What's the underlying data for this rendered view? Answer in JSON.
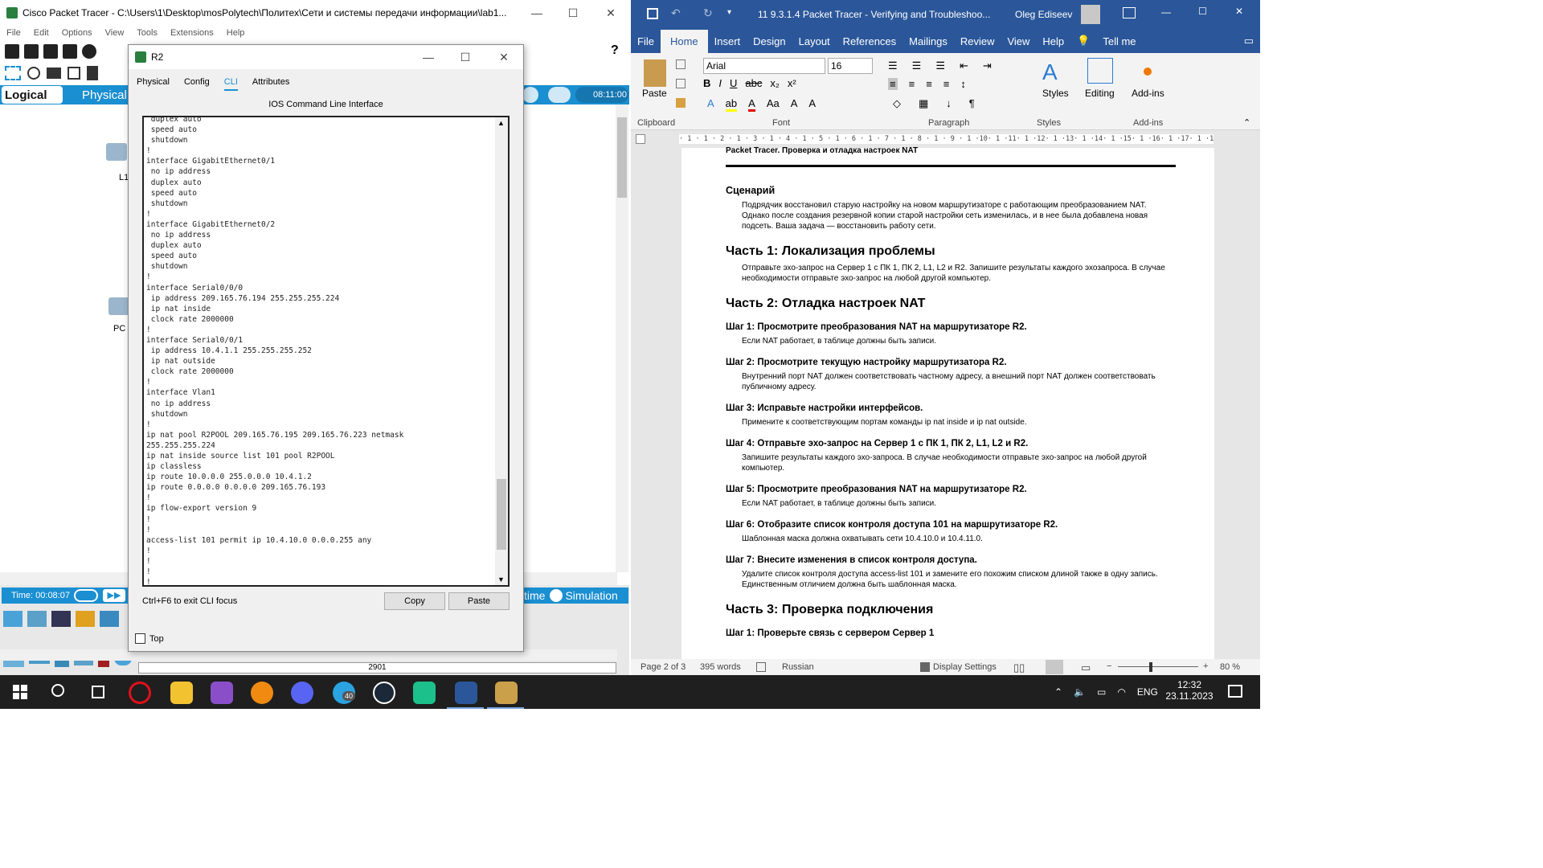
{
  "packet_tracer": {
    "title": "Cisco Packet Tracer - C:\\Users\\1\\Desktop\\mosPolytech\\Политех\\Сети и системы передачи информации\\lab1...",
    "menu": [
      "File",
      "Edit",
      "Options",
      "View",
      "Tools",
      "Extensions",
      "Help"
    ],
    "help_mark": "?",
    "logical_label": "Logical",
    "physical_label": "Physical",
    "clock": "08:11:00",
    "device_labels": [
      "L1",
      "PC"
    ],
    "time_label": "Time: 00:08:07",
    "realtime_label": "time",
    "simulation_label": "Simulation",
    "model_label": "2901"
  },
  "dialog": {
    "title": "R2",
    "tabs": [
      "Physical",
      "Config",
      "CLI",
      "Attributes"
    ],
    "active_tab": "CLI",
    "cli_header": "IOS Command Line Interface",
    "cli_text": " duplex auto\n speed auto\n shutdown\n!\ninterface GigabitEthernet0/1\n no ip address\n duplex auto\n speed auto\n shutdown\n!\ninterface GigabitEthernet0/2\n no ip address\n duplex auto\n speed auto\n shutdown\n!\ninterface Serial0/0/0\n ip address 209.165.76.194 255.255.255.224\n ip nat inside\n clock rate 2000000\n!\ninterface Serial0/0/1\n ip address 10.4.1.1 255.255.255.252\n ip nat outside\n clock rate 2000000\n!\ninterface Vlan1\n no ip address\n shutdown\n!\nip nat pool R2POOL 209.165.76.195 209.165.76.223 netmask\n255.255.255.224\nip nat inside source list 101 pool R2POOL\nip classless\nip route 10.0.0.0 255.0.0.0 10.4.1.2\nip route 0.0.0.0 0.0.0.0 209.165.76.193\n!\nip flow-export version 9\n!\n!\naccess-list 101 permit ip 10.4.10.0 0.0.0.255 any\n!\n!\n!\n!",
    "hint": "Ctrl+F6 to exit CLI focus",
    "copy_label": "Copy",
    "paste_label": "Paste",
    "top_label": "Top"
  },
  "word": {
    "title": "11 9.3.1.4 Packet Tracer - Verifying and Troubleshoo...",
    "user": "Oleg Ediseev",
    "tabs": [
      "File",
      "Home",
      "Insert",
      "Design",
      "Layout",
      "References",
      "Mailings",
      "Review",
      "View",
      "Help"
    ],
    "tell_me": "Tell me",
    "font": "Arial",
    "size": "16",
    "groups": {
      "clipboard": "Clipboard",
      "font": "Font",
      "paragraph": "Paragraph",
      "styles": "Styles",
      "addins": "Add-ins"
    },
    "paste_label": "Paste",
    "styles_label": "Styles",
    "editing_label": "Editing",
    "addins_label": "Add-ins",
    "ruler": "· 1 · 1 · 2 · 1 · 3 · 1 · 4 · 1 · 5 · 1 · 6 · 1 · 7 · 1 · 8 · 1 · 9 · 1 ·10· 1 ·11· 1 ·12· 1 ·13· 1 ·14· 1 ·15· 1 ·16· 1 ·17· 1 ·18· 1 ·19·",
    "doc": {
      "header": "Packet Tracer. Проверка и отладка настроек NAT",
      "scenario_h": "Сценарий",
      "scenario_p": "Подрядчик восстановил старую настройку на новом маршрутизаторе с работающим преобразованием NAT. Однако после создания резервной копии старой настройки сеть изменилась, и в нее была добавлена новая подсеть. Ваша задача — восстановить работу сети.",
      "part1_h": "Часть 1: Локализация проблемы",
      "part1_p": "Отправьте эхо-запрос на Сервер 1 с ПК 1, ПК 2, L1, L2 и R2. Запишите результаты каждого эхозапроса. В случае необходимости отправьте эхо-запрос на любой другой компьютер.",
      "part2_h": "Часть 2: Отладка настроек NAT",
      "steps": [
        {
          "h": "Шаг 1: Просмотрите преобразования NAT на маршрутизаторе R2.",
          "p": "Если NAT работает, в таблице должны быть записи."
        },
        {
          "h": "Шаг 2: Просмотрите текущую настройку маршрутизатора R2.",
          "p": "Внутренний порт NAT должен соответствовать частному адресу, а внешний порт NAT должен соответствовать публичному адресу."
        },
        {
          "h": "Шаг 3: Исправьте настройки интерфейсов.",
          "p": "Примените к соответствующим портам команды ip nat inside и ip nat outside."
        },
        {
          "h": "Шаг 4: Отправьте эхо-запрос на Сервер 1 с ПК 1, ПК 2, L1, L2 и R2.",
          "p": "Запишите результаты каждого эхо-запроса. В случае необходимости отправьте эхо-запрос на любой другой компьютер."
        },
        {
          "h": "Шаг 5: Просмотрите преобразования NAT на маршрутизаторе R2.",
          "p": "Если NAT работает, в таблице должны быть записи."
        },
        {
          "h": "Шаг 6: Отобразите список контроля доступа 101 на маршрутизаторе R2.",
          "p": "Шаблонная маска должна охватывать сети 10.4.10.0 и 10.4.11.0."
        },
        {
          "h": "Шаг 7: Внесите изменения в список контроля доступа.",
          "p": "Удалите список контроля доступа access-list 101 и замените его похожим списком длиной также в одну запись. Единственным отличием должна быть шаблонная маска."
        }
      ],
      "part3_h": "Часть 3: Проверка подключения",
      "last_step": "Шаг 1: Проверьте связь с сервером Сервер 1"
    },
    "status": {
      "page": "Page 2 of 3",
      "words": "395 words",
      "language": "Russian",
      "display": "Display Settings",
      "zoom": "80 %"
    }
  },
  "taskbar": {
    "lang": "ENG",
    "time": "12:32",
    "date": "23.11.2023",
    "telegram_badge": "40"
  },
  "colors": {
    "pt_blue": "#1a8fd1",
    "word_blue": "#2b579a",
    "taskbar": "#1f1f1f"
  }
}
